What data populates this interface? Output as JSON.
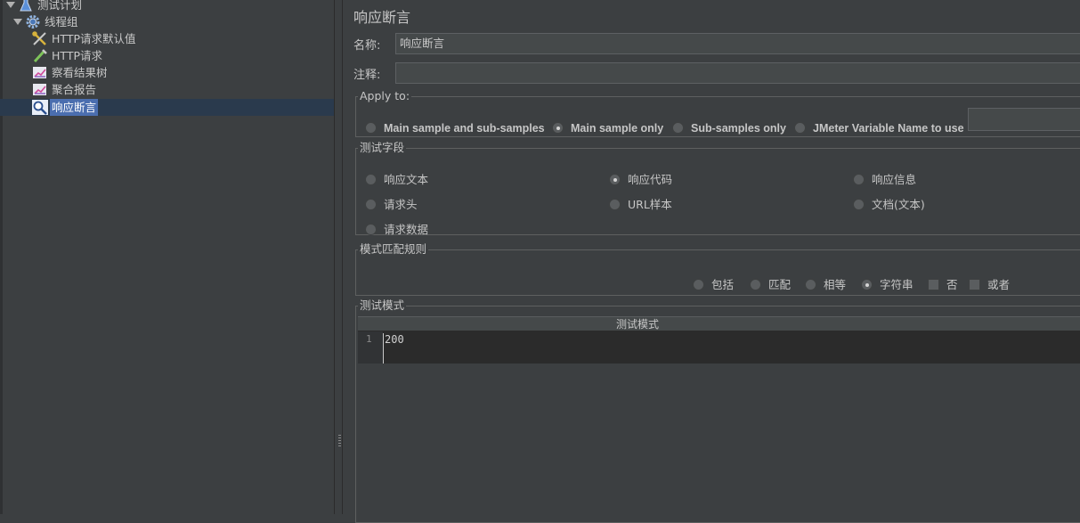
{
  "tree": {
    "items": [
      {
        "label": "测试计划",
        "icon": "flask-icon"
      },
      {
        "label": "线程组",
        "icon": "gear-icon"
      },
      {
        "label": "HTTP请求默认值",
        "icon": "wrench-icon"
      },
      {
        "label": "HTTP请求",
        "icon": "pipette-icon"
      },
      {
        "label": "察看结果树",
        "icon": "chart-icon"
      },
      {
        "label": "聚合报告",
        "icon": "chart-icon"
      },
      {
        "label": "响应断言",
        "icon": "magnifier-icon"
      }
    ],
    "selected": "响应断言"
  },
  "panel": {
    "title": "响应断言",
    "name_label": "名称:",
    "name_value": "响应断言",
    "comment_label": "注释:",
    "comment_value": ""
  },
  "apply_to": {
    "legend": "Apply to:",
    "options": [
      "Main sample and sub-samples",
      "Main sample only",
      "Sub-samples only",
      "JMeter Variable Name to use"
    ],
    "selected": "Main sample only",
    "variable_value": ""
  },
  "test_field": {
    "legend": "测试字段",
    "options": [
      "响应文本",
      "响应代码",
      "响应信息",
      "请求头",
      "URL样本",
      "文档(文本)",
      "请求数据"
    ],
    "selected": "响应代码"
  },
  "match_rule": {
    "legend": "模式匹配规则",
    "radio_options": [
      "包括",
      "匹配",
      "相等",
      "字符串"
    ],
    "selected": "字符串",
    "checkbox_options": [
      "否",
      "或者"
    ],
    "checked": []
  },
  "patterns": {
    "legend": "测试模式",
    "column_header": "测试模式",
    "rows": [
      {
        "line": "1",
        "value": "200"
      }
    ]
  },
  "colors": {
    "background": "#3c3f41",
    "selection": "#4b6eaf",
    "editor": "#2b2b2b"
  }
}
